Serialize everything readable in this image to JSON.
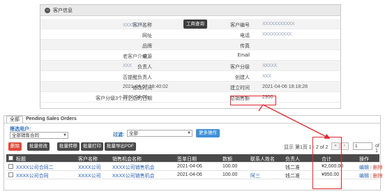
{
  "info": {
    "header_icon": "minus-circle-icon",
    "title": "客户信息",
    "query_button": "工商查询",
    "rows": [
      {
        "l_label": "客户名称",
        "l_value": "XXXX公司",
        "r_label": "客户编号",
        "r_value": "XXXXXXXXXXX",
        "l_blur": true,
        "r_blur": true
      },
      {
        "l_label": "网址",
        "l_value": "",
        "r_label": "电话",
        "r_value": "XXXXXXXXXX",
        "r_blur": true
      },
      {
        "l_label": "品牌",
        "l_value": "",
        "r_label": "传真",
        "r_value": ""
      },
      {
        "l_label": "来源",
        "l_value": "老客户介绍",
        "r_label": "Email",
        "r_value": ""
      },
      {
        "l_label": "负责人",
        "l_value": "XXX",
        "r_label": "客户分级",
        "r_value": "XXXXX",
        "l_blur": true,
        "r_blur": true
      },
      {
        "l_label": "提醒负责人",
        "l_value": "否",
        "r_label": "创建人",
        "r_value": "XXX",
        "r_blur": true
      },
      {
        "l_label": "修改时间",
        "l_value": "2021-04-07 18:40:02",
        "r_label": "建立时间",
        "r_value": "2021-04-06 18:18:28"
      },
      {
        "l_label": "客户分级3个月之后的日期",
        "l_value": "2021-04-06",
        "r_label": "总销售额",
        "r_value": "2950"
      }
    ]
  },
  "orders": {
    "tabs": [
      "全部",
      "Pending Sales Orders"
    ],
    "filter_label": "筛选用户:",
    "filter_value": "全部销售合同",
    "scope_label": "过滤:",
    "scope_value": "全部",
    "more_ops": "更多操作",
    "actions": [
      "删除",
      "批量修改",
      "批量转移",
      "批量打印",
      "批量导出PDF"
    ],
    "page_info": "显示 第1页 1 - 2 of 2",
    "page_value": "1",
    "page_of": "of 1",
    "pager_icons": [
      "first-page-icon",
      "prev-page-icon",
      "next-page-icon",
      "last-page-icon"
    ],
    "columns": [
      "标题",
      "客户名称",
      "销售机会名称",
      "签单日期",
      "数额",
      "联系人姓名",
      "负责人",
      "合计",
      "操作"
    ],
    "rows": [
      {
        "title": "XXXX公司合同二",
        "customer": "XXXX公司",
        "opportunity": "XXXX公司销售机会",
        "date": "2021-04-06",
        "amount": "100.00",
        "contact": "",
        "owner": "钱二准",
        "total": "¥2,000.00",
        "edit": "编辑",
        "delete": "删除"
      },
      {
        "title": "XXXX公司合同",
        "customer": "XXXX公司",
        "opportunity": "XXXX公司销售机会",
        "date": "2021-04-06",
        "amount": "100.00",
        "contact": "阿三",
        "owner": "钱二准",
        "total": "¥950.00",
        "edit": "编辑",
        "delete": "删除"
      }
    ]
  },
  "colors": {
    "highlight": "#e0282e",
    "link": "#2c62b1",
    "button_dark": "#4a4a4a",
    "button_blue": "#3f90d8",
    "delete_red": "#e04a3c"
  }
}
